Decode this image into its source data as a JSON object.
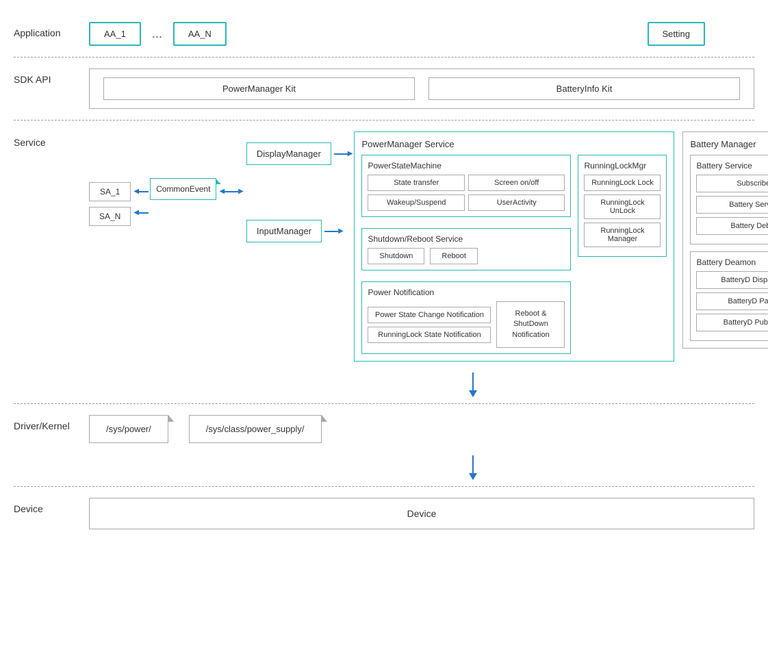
{
  "layers": {
    "application": {
      "label": "Application",
      "apps": [
        "AA_1",
        "...",
        "AA_N",
        "Setting"
      ]
    },
    "sdk": {
      "label": "SDK API",
      "kits": [
        "PowerManager Kit",
        "BatteryInfo Kit"
      ]
    },
    "service": {
      "label": "Service",
      "left_managers": [
        "DisplayManager",
        "InputManager"
      ],
      "sa_boxes": [
        "SA_1",
        "SA_N"
      ],
      "common_event": "CommonEvent",
      "pm_service": {
        "title": "PowerManager Service",
        "psm": {
          "title": "PowerStateMachine",
          "items": [
            "State transfer",
            "Screen on/off",
            "Wakeup/Suspend",
            "UserActivity"
          ]
        },
        "srs": {
          "title": "Shutdown/Reboot Service",
          "items": [
            "Shutdown",
            "Reboot"
          ]
        },
        "pn": {
          "title": "Power Notification",
          "items": [
            "Power State Change Notification",
            "RunningLock State Notification"
          ],
          "right": "Reboot &\nShutDown Notification"
        },
        "rlm": {
          "title": "RunningLockMgr",
          "items": [
            "RunningLock Lock",
            "RunningLock UnLock",
            "RunningLock Manager"
          ]
        }
      },
      "battery_manager": {
        "title": "Battery Manager",
        "battery_service": {
          "title": "Battery Service",
          "items": [
            "Subscriber",
            "Battery Service",
            "Battery Debug"
          ]
        },
        "battery_daemon": {
          "title": "Battery Deamon",
          "items": [
            "BatteryD Dispatcher",
            "BatteryD Parser",
            "BatteryD Publisher"
          ]
        }
      }
    },
    "driver": {
      "label": "Driver/Kernel",
      "boxes": [
        "/sys/power/",
        "/sys/class/power_supply/"
      ]
    },
    "device": {
      "label": "Device",
      "text": "Device"
    }
  }
}
